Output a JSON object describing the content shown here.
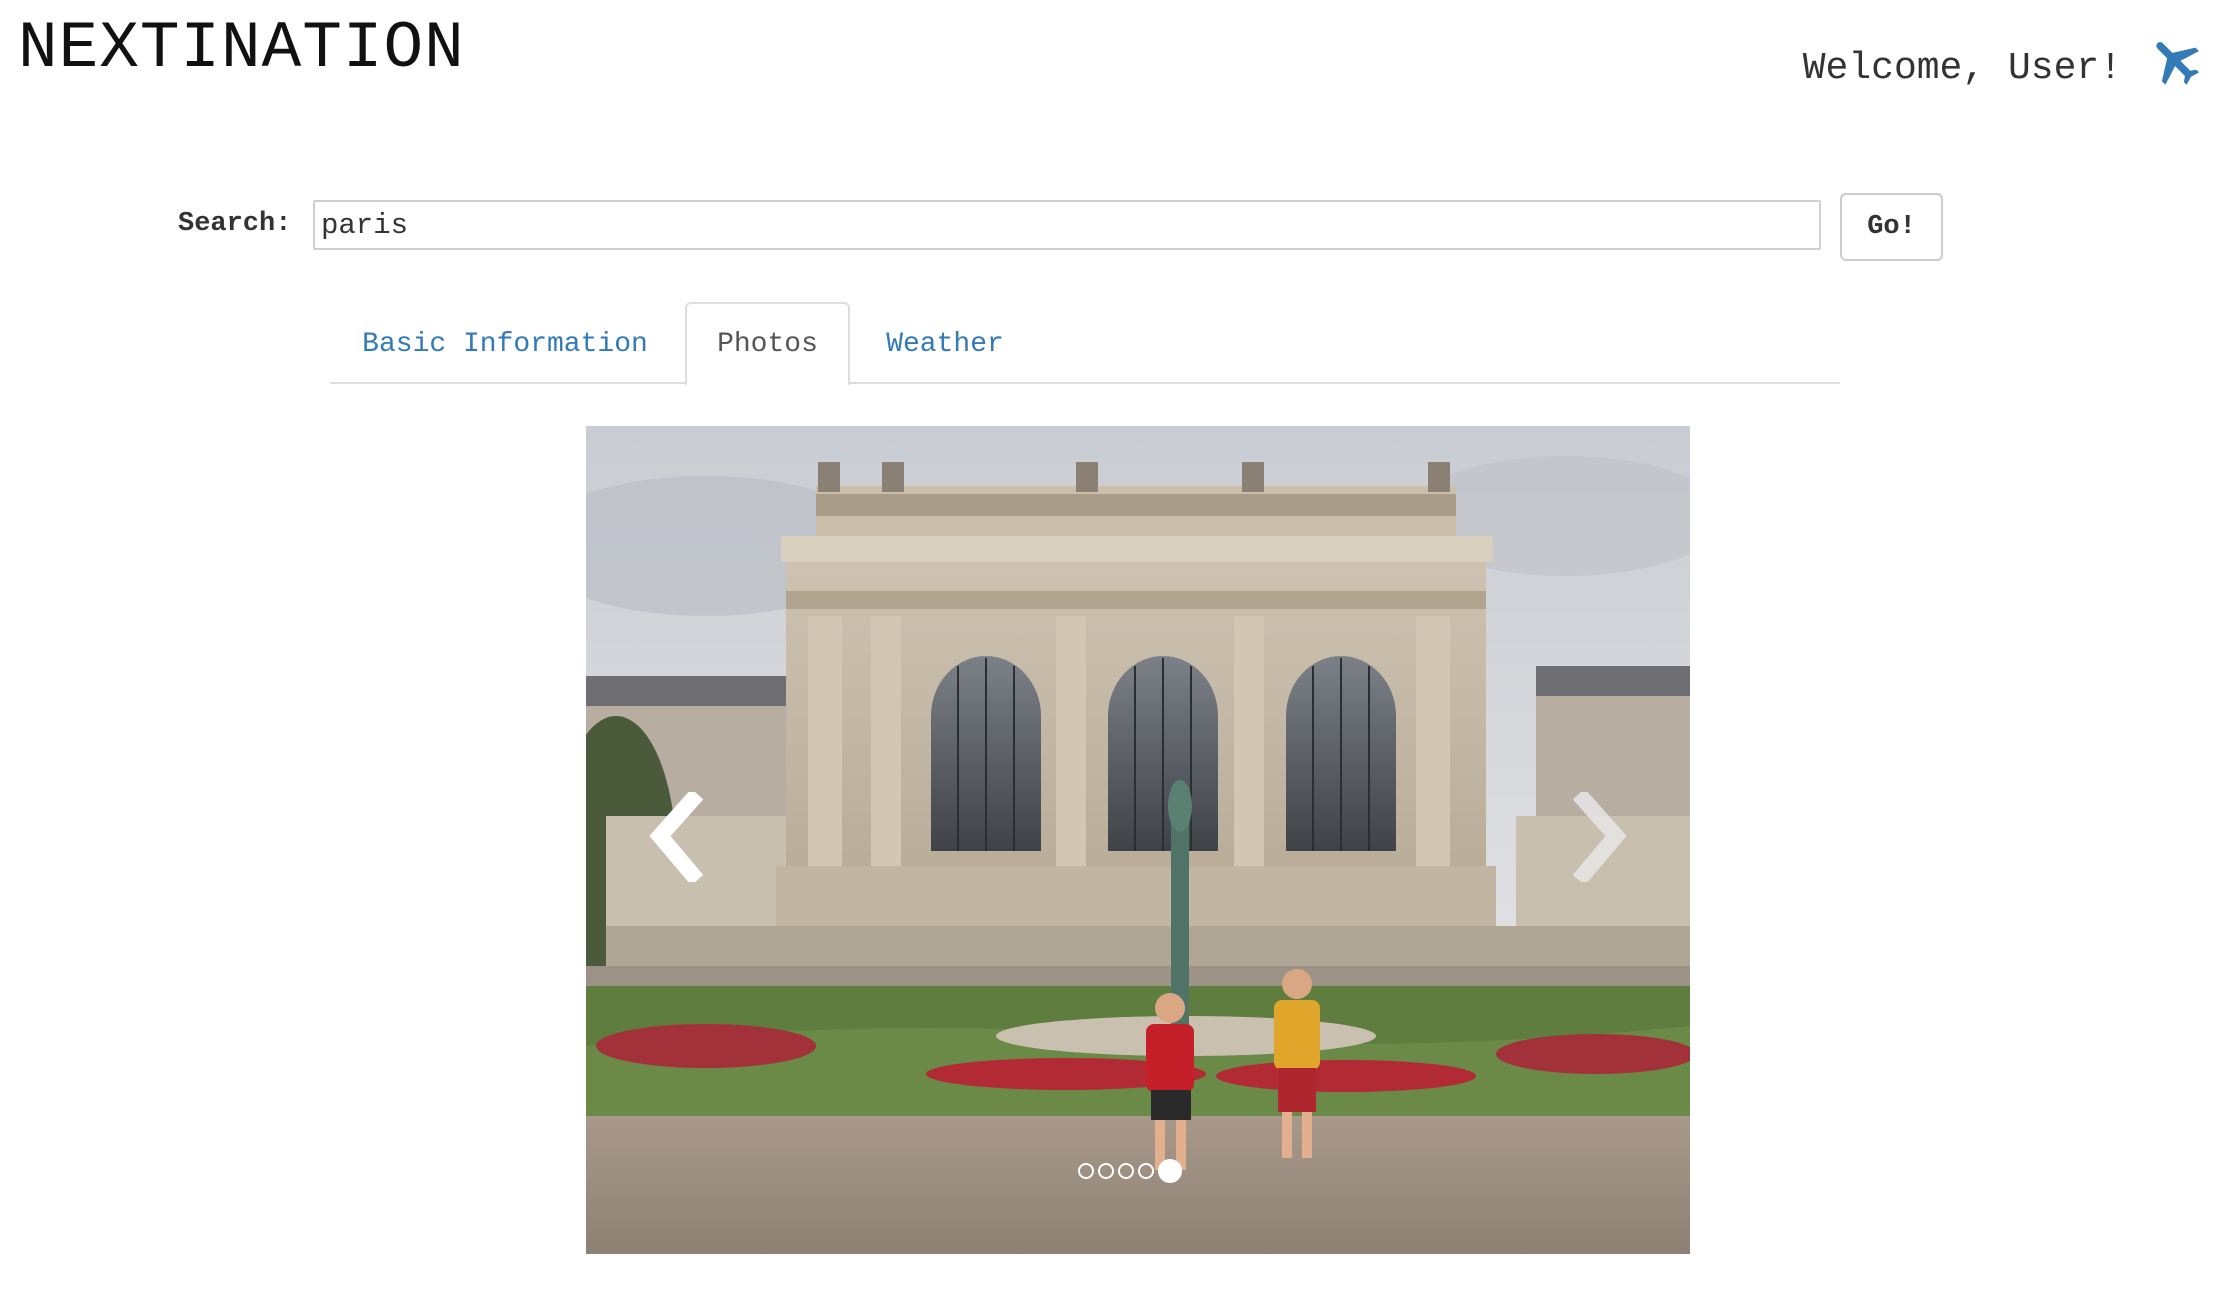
{
  "header": {
    "brand": "NEXTINATION",
    "welcome": "Welcome, User!",
    "icon": "airplane-icon",
    "icon_color": "#337ab7"
  },
  "search": {
    "label": "Search:",
    "value": "paris",
    "button_label": "Go!"
  },
  "tabs": [
    {
      "label": "Basic Information",
      "active": false
    },
    {
      "label": "Photos",
      "active": true
    },
    {
      "label": "Weather",
      "active": false
    }
  ],
  "carousel": {
    "slide_count": 5,
    "active_index": 4,
    "prev_icon": "chevron-left-icon",
    "next_icon": "chevron-right-icon"
  },
  "colors": {
    "link": "#337ab7",
    "text": "#333333",
    "border": "#dddddd"
  }
}
